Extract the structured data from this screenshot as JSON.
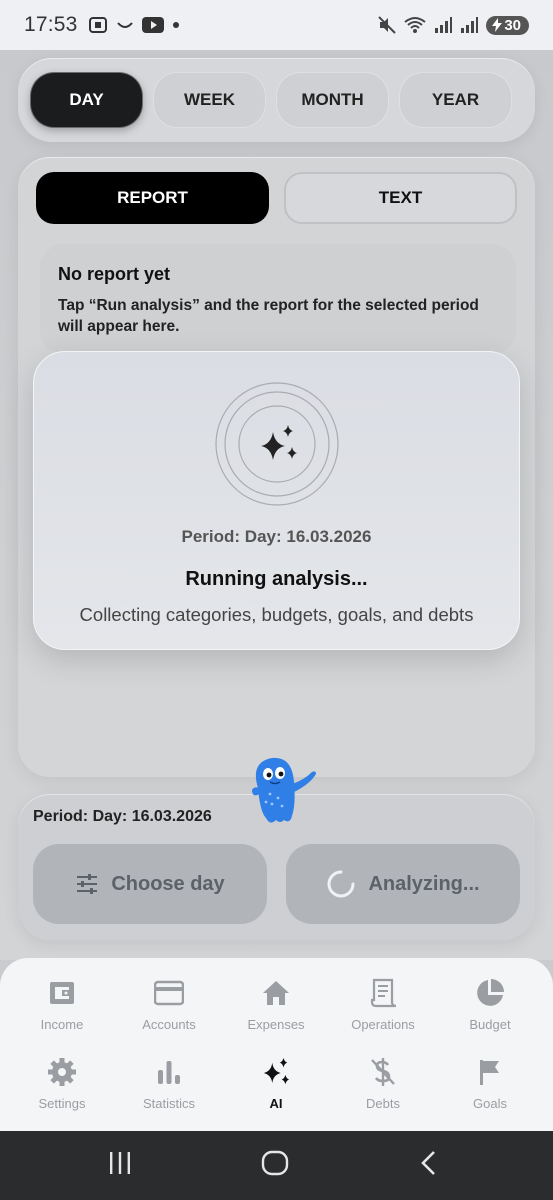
{
  "status_bar": {
    "time": "17:53",
    "battery": "30",
    "icons": [
      "screenshot-icon",
      "youtube-icon",
      "dot-icon",
      "mute-icon",
      "wifi-icon",
      "signal-icon",
      "signal-icon-2",
      "battery-charging-icon"
    ]
  },
  "period_tabs": [
    {
      "label": "DAY",
      "active": true
    },
    {
      "label": "WEEK",
      "active": false
    },
    {
      "label": "MONTH",
      "active": false
    },
    {
      "label": "YEAR",
      "active": false
    }
  ],
  "view_toggle": {
    "report_label": "REPORT",
    "text_label": "TEXT",
    "active": "report"
  },
  "empty_report": {
    "title": "No report yet",
    "body": "Tap “Run analysis” and the report for the selected period will appear here."
  },
  "analysis_overlay": {
    "period": "Period: Day: 16.03.2026",
    "title": "Running analysis...",
    "subtitle": "Collecting categories, budgets, goals, and debts",
    "icon": "sparkles-icon"
  },
  "action_panel": {
    "period": "Period: Day: 16.03.2026",
    "choose_label": "Choose day",
    "choose_icon": "sliders-icon",
    "analyze_label": "Analyzing...",
    "analyze_icon": "spinner-icon"
  },
  "bottom_nav": {
    "row1": [
      {
        "label": "Income",
        "icon": "wallet-icon"
      },
      {
        "label": "Accounts",
        "icon": "credit-card-icon"
      },
      {
        "label": "Expenses",
        "icon": "home-icon"
      },
      {
        "label": "Operations",
        "icon": "receipt-icon"
      },
      {
        "label": "Budget",
        "icon": "pie-chart-icon"
      }
    ],
    "row2": [
      {
        "label": "Settings",
        "icon": "gear-icon"
      },
      {
        "label": "Statistics",
        "icon": "bar-chart-icon"
      },
      {
        "label": "AI",
        "icon": "sparkles-icon",
        "active": true
      },
      {
        "label": "Debts",
        "icon": "dollar-crossed-icon"
      },
      {
        "label": "Goals",
        "icon": "flag-icon"
      }
    ]
  },
  "colors": {
    "active_tab": "#1b1c1e",
    "report_button": "#000000",
    "inactive_nav": "#9a9da2",
    "mascot": "#2f7fe6"
  }
}
